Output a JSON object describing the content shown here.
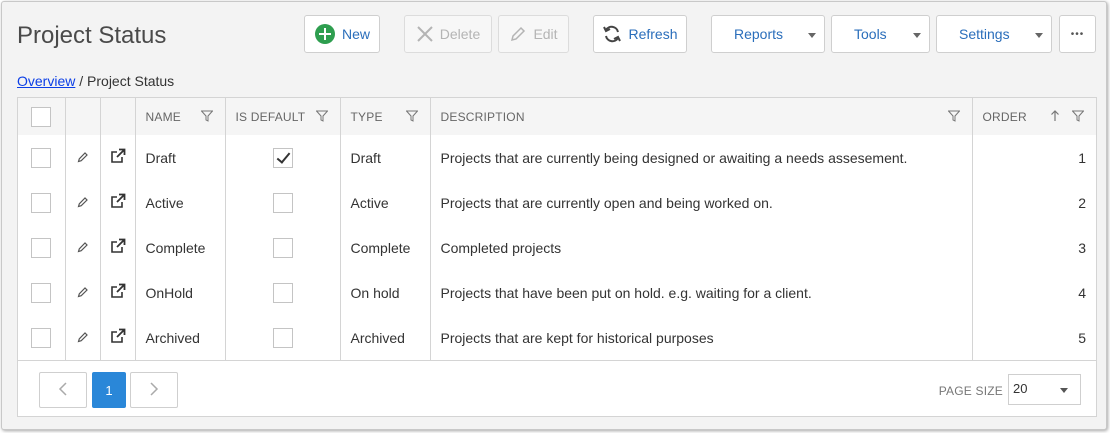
{
  "page": {
    "title": "Project Status"
  },
  "toolbar": {
    "new_label": "New",
    "delete_label": "Delete",
    "edit_label": "Edit",
    "refresh_label": "Refresh",
    "reports_label": "Reports",
    "tools_label": "Tools",
    "settings_label": "Settings",
    "more_label": "•••"
  },
  "breadcrumb": {
    "link": "Overview",
    "separator": " / ",
    "current": "Project Status"
  },
  "table": {
    "columns": [
      "NAME",
      "IS DEFAULT",
      "TYPE",
      "DESCRIPTION",
      "ORDER"
    ],
    "rows": [
      {
        "name": "Draft",
        "is_default": true,
        "type": "Draft",
        "description": "Projects that are currently being designed or awaiting a needs assesement.",
        "order": "1"
      },
      {
        "name": "Active",
        "is_default": false,
        "type": "Active",
        "description": "Projects that are currently open and being worked on.",
        "order": "2"
      },
      {
        "name": "Complete",
        "is_default": false,
        "type": "Complete",
        "description": "Completed projects",
        "order": "3"
      },
      {
        "name": "OnHold",
        "is_default": false,
        "type": "On hold",
        "description": "Projects that have been put on hold. e.g. waiting for a client.",
        "order": "4"
      },
      {
        "name": "Archived",
        "is_default": false,
        "type": "Archived",
        "description": "Projects that are kept for historical purposes",
        "order": "5"
      }
    ]
  },
  "pager": {
    "current_page": "1",
    "page_size_label": "PAGE SIZE",
    "page_size": "20"
  },
  "colors": {
    "accent": "#2a6ebb",
    "new_icon": "#2e9e4f",
    "active_page": "#2a87d8"
  }
}
